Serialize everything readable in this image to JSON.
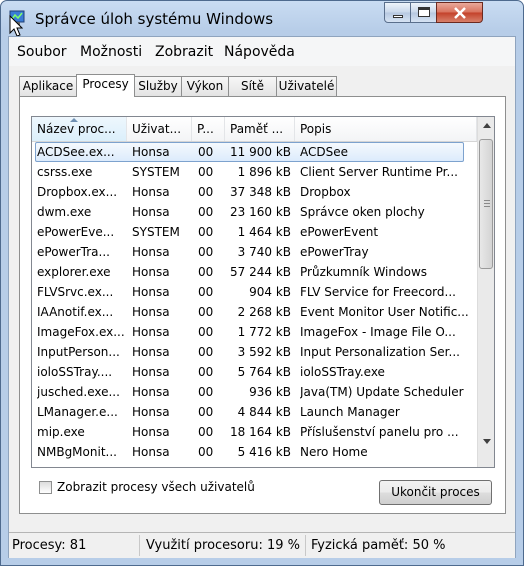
{
  "window": {
    "title": "Správce úloh systému Windows"
  },
  "menu": [
    "Soubor",
    "Možnosti",
    "Zobrazit",
    "Nápověda"
  ],
  "tabs": [
    "Aplikace",
    "Procesy",
    "Služby",
    "Výkon",
    "Sítě",
    "Uživatelé"
  ],
  "active_tab": "Procesy",
  "columns": [
    "Název proc...",
    "Uživat...",
    "P...",
    "Paměť ...",
    "Popis"
  ],
  "processes": [
    {
      "name": "ACDSee.ex...",
      "user": "Honsa",
      "cpu": "00",
      "memory": "11 900 kB",
      "desc": "ACDSee",
      "selected": true
    },
    {
      "name": "csrss.exe",
      "user": "SYSTEM",
      "cpu": "00",
      "memory": "1 896 kB",
      "desc": "Client Server Runtime Pr..."
    },
    {
      "name": "Dropbox.ex...",
      "user": "Honsa",
      "cpu": "00",
      "memory": "37 348 kB",
      "desc": "Dropbox"
    },
    {
      "name": "dwm.exe",
      "user": "Honsa",
      "cpu": "00",
      "memory": "23 160 kB",
      "desc": "Správce oken plochy"
    },
    {
      "name": "ePowerEve...",
      "user": "SYSTEM",
      "cpu": "00",
      "memory": "1 464 kB",
      "desc": "ePowerEvent"
    },
    {
      "name": "ePowerTra...",
      "user": "Honsa",
      "cpu": "00",
      "memory": "3 740 kB",
      "desc": "ePowerTray"
    },
    {
      "name": "explorer.exe",
      "user": "Honsa",
      "cpu": "00",
      "memory": "57 244 kB",
      "desc": "Průzkumník Windows"
    },
    {
      "name": "FLVSrvc.ex...",
      "user": "Honsa",
      "cpu": "00",
      "memory": "904 kB",
      "desc": "FLV Service for Freecord..."
    },
    {
      "name": "IAAnotif.ex...",
      "user": "Honsa",
      "cpu": "00",
      "memory": "2 268 kB",
      "desc": "Event Monitor User Notific..."
    },
    {
      "name": "ImageFox.ex...",
      "user": "Honsa",
      "cpu": "00",
      "memory": "1 772 kB",
      "desc": "ImageFox - Image File O..."
    },
    {
      "name": "InputPerson...",
      "user": "Honsa",
      "cpu": "00",
      "memory": "3 592 kB",
      "desc": "Input Personalization Ser..."
    },
    {
      "name": "ioloSSTray....",
      "user": "Honsa",
      "cpu": "00",
      "memory": "5 764 kB",
      "desc": "ioloSSTray.exe"
    },
    {
      "name": "jusched.exe...",
      "user": "Honsa",
      "cpu": "00",
      "memory": "936 kB",
      "desc": "Java(TM) Update Scheduler"
    },
    {
      "name": "LManager.e...",
      "user": "Honsa",
      "cpu": "00",
      "memory": "4 844 kB",
      "desc": "Launch Manager"
    },
    {
      "name": "mip.exe",
      "user": "Honsa",
      "cpu": "00",
      "memory": "18 164 kB",
      "desc": "Příslušenství panelu pro ..."
    },
    {
      "name": "NMBgMonit...",
      "user": "Honsa",
      "cpu": "00",
      "memory": "5 416 kB",
      "desc": "Nero Home"
    }
  ],
  "show_all_users_label": "Zobrazit procesy všech uživatelů",
  "show_all_users_checked": false,
  "end_process_label": "Ukončit proces",
  "status": {
    "processes": "Procesy: 81",
    "cpu": "Využití procesoru: 19 %",
    "memory": "Fyzická paměť: 50 %"
  },
  "colors": {
    "selection_border": "#7da2ce",
    "title_bar": "#b7cde8",
    "close_button": "#c3412a"
  }
}
